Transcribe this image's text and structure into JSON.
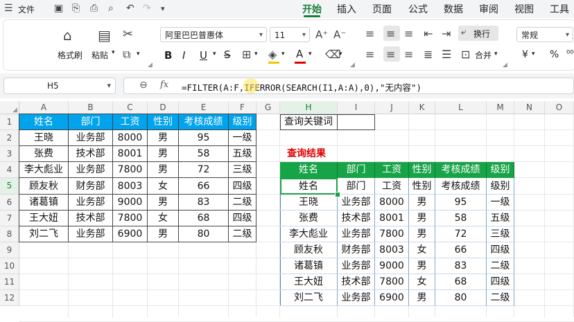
{
  "menubar": {
    "file_label": "文件",
    "tabs": [
      "开始",
      "插入",
      "页面",
      "公式",
      "数据",
      "审阅",
      "视图",
      "工具"
    ],
    "active_tab": "开始"
  },
  "ribbon": {
    "format_painter": "格式刷",
    "paste": "粘贴",
    "font_name": "阿里巴巴普惠体",
    "font_size": "11",
    "bold": "B",
    "italic": "I",
    "underline": "U",
    "wrap_text": "换行",
    "merge": "合并",
    "number_format": "常规",
    "currency": "¥",
    "percent": "%"
  },
  "formula_bar": {
    "cell_ref": "H5",
    "fx": "fx",
    "formula": "=FILTER(A:F,IFERROR(SEARCH(I1,A:A),0),\"无内容\")"
  },
  "sheet": {
    "columns": [
      "A",
      "B",
      "C",
      "D",
      "E",
      "F",
      "G",
      "H",
      "I",
      "J",
      "K",
      "L",
      "M",
      "N",
      "O"
    ],
    "rows": [
      "1",
      "2",
      "3",
      "4",
      "5",
      "6",
      "7",
      "8",
      "9",
      "10",
      "11",
      "12"
    ],
    "selected_column": "H",
    "selected_row": "5",
    "source_header": [
      "姓名",
      "部门",
      "工资",
      "性别",
      "考核成绩",
      "级别"
    ],
    "source_rows": [
      [
        "王晓",
        "业务部",
        "8000",
        "男",
        "95",
        "一级"
      ],
      [
        "张费",
        "技术部",
        "8001",
        "男",
        "58",
        "五级"
      ],
      [
        "李大彪业",
        "业务部",
        "7800",
        "男",
        "72",
        "三级"
      ],
      [
        "顾友秋",
        "财务部",
        "8003",
        "女",
        "66",
        "四级"
      ],
      [
        "诸葛镇",
        "业务部",
        "9000",
        "男",
        "83",
        "二级"
      ],
      [
        "王大妞",
        "技术部",
        "7800",
        "女",
        "68",
        "四级"
      ],
      [
        "刘二飞",
        "业务部",
        "6900",
        "男",
        "80",
        "二级"
      ]
    ],
    "query_label": "查询关键词",
    "query_value": "",
    "result_title": "查询结果",
    "result_header": [
      "姓名",
      "部门",
      "工资",
      "性别",
      "考核成绩",
      "级别"
    ],
    "result_rows": [
      [
        "姓名",
        "部门",
        "工资",
        "性别",
        "考核成绩",
        "级别"
      ],
      [
        "王晓",
        "业务部",
        "8000",
        "男",
        "95",
        "一级"
      ],
      [
        "张费",
        "技术部",
        "8001",
        "男",
        "58",
        "五级"
      ],
      [
        "李大彪业",
        "业务部",
        "7800",
        "男",
        "72",
        "三级"
      ],
      [
        "顾友秋",
        "财务部",
        "8003",
        "女",
        "66",
        "四级"
      ],
      [
        "诸葛镇",
        "业务部",
        "9000",
        "男",
        "83",
        "二级"
      ],
      [
        "王大妞",
        "技术部",
        "7800",
        "女",
        "68",
        "四级"
      ],
      [
        "刘二飞",
        "业务部",
        "6900",
        "男",
        "80",
        "二级"
      ]
    ]
  },
  "colors": {
    "accent": "#1a7f37",
    "source_header_bg": "#00a3ec",
    "result_header_bg": "#17a347",
    "result_title": "#e00000"
  }
}
